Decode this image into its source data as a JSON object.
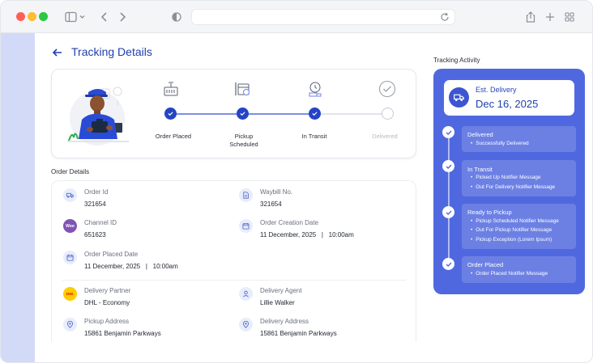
{
  "page": {
    "title": "Tracking Details"
  },
  "progress": {
    "steps": [
      {
        "label": "Order Placed",
        "status": "done"
      },
      {
        "label": "Pickup\nScheduled",
        "status": "done"
      },
      {
        "label": "In Transit",
        "status": "done"
      },
      {
        "label": "Delivered",
        "status": "pending"
      }
    ]
  },
  "order_details": {
    "section_label": "Order Details",
    "order_id": {
      "label": "Order Id",
      "value": "321654"
    },
    "waybill": {
      "label": "Waybill No.",
      "value": "321654"
    },
    "channel_id": {
      "label": "Channel ID",
      "value": "651623",
      "badge": "Woo"
    },
    "order_creation_date": {
      "label": "Order Creation Date",
      "value": "11 December, 2025   |   10:00am"
    },
    "order_placed_date": {
      "label": "Order Placed Date",
      "value": "11 December, 2025   |   10:00am"
    },
    "delivery_partner": {
      "label": "Delivery Partner",
      "value": "DHL - Economy",
      "badge": "DHL"
    },
    "delivery_agent": {
      "label": "Delivery Agent",
      "value": "Lillie Walker"
    },
    "pickup_address": {
      "label": "Pickup Address",
      "value": "15861 Benjamin Parkways"
    },
    "delivery_address": {
      "label": "Delivery Address",
      "value": "15861 Benjamin Parkways"
    }
  },
  "activity": {
    "section_label": "Tracking Activity",
    "est_label": "Est. Delivery",
    "est_date": "Dec 16, 2025",
    "events": [
      {
        "title": "Delivered",
        "items": [
          "Successfully Delivered"
        ]
      },
      {
        "title": "In Transit",
        "items": [
          "Picked Up Notifier Message",
          "Out For Delivery Notifier Message"
        ]
      },
      {
        "title": "Ready to Pickup",
        "items": [
          "Pickup Scheduled Notifier Message",
          "Out For Pickup Notifier Message",
          "Pickup Exception (Lorem Ipsum)"
        ]
      },
      {
        "title": "Order Placed",
        "items": [
          "Order Placed Notifier Message"
        ]
      }
    ]
  },
  "colors": {
    "accent": "#2444c8",
    "panel": "#5068df",
    "sidebar": "#d3daf7"
  }
}
